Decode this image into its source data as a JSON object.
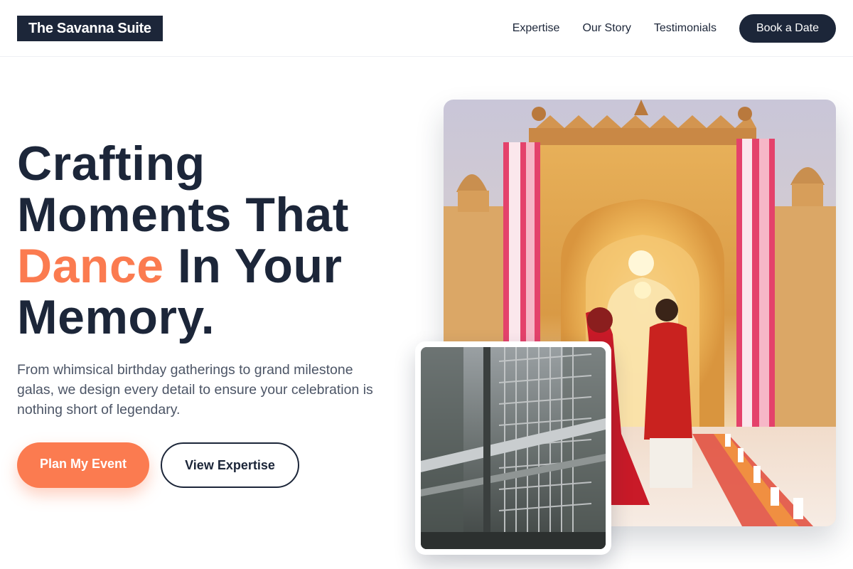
{
  "brand": {
    "name": "The Savanna Suite"
  },
  "nav": {
    "links": [
      "Expertise",
      "Our Story",
      "Testimonials"
    ],
    "cta_label": "Book a Date"
  },
  "hero": {
    "headline_line1": "Crafting",
    "headline_line2": "Moments That",
    "headline_accent": "Dance",
    "headline_line3_rest": " In Your",
    "headline_line4": "Memory.",
    "subtext": "From whimsical birthday gatherings to grand milestone galas, we design every detail to ensure your celebration is nothing short of legendary.",
    "primary_cta": "Plan My Event",
    "secondary_cta": "View Expertise"
  },
  "colors": {
    "navy": "#1c2639",
    "accent": "#fb7b50",
    "body_text": "#4c5566"
  },
  "images": {
    "main": "wedding-couple-palace-photo",
    "secondary": "metal-grid-structure-photo"
  }
}
